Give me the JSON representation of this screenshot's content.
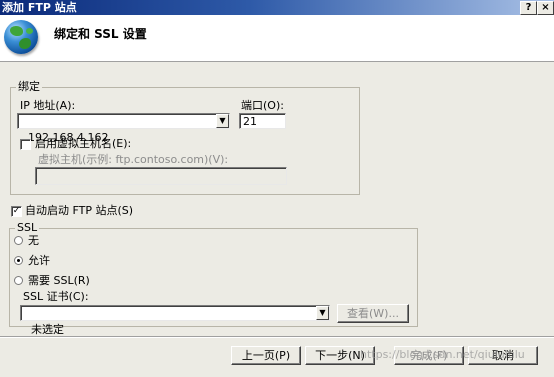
{
  "window": {
    "title": "添加 FTP 站点",
    "help_glyph": "?",
    "close_glyph": "×"
  },
  "header": {
    "icon": "globe-icon",
    "title": "绑定和 SSL 设置"
  },
  "binding": {
    "legend": "绑定",
    "ip_label": "IP 地址(A):",
    "ip_value": "192.168.4.162",
    "port_label": "端口(O):",
    "port_value": "21",
    "virtual_host_checkbox_label": "启用虚拟主机名(E):",
    "virtual_host_checked": false,
    "virtual_host_label": "虚拟主机(示例: ftp.contoso.com)(V):",
    "virtual_host_value": ""
  },
  "auto_start": {
    "label": "自动启动 FTP 站点(S)",
    "checked": true
  },
  "ssl": {
    "legend": "SSL",
    "options": [
      {
        "label": "无",
        "selected": false
      },
      {
        "label": "允许",
        "selected": true
      },
      {
        "label": "需要 SSL(R)",
        "selected": false
      }
    ],
    "cert_label": "SSL 证书(C):",
    "cert_value": "未选定",
    "view_button": "查看(W)..."
  },
  "footer": {
    "prev": "上一页(P)",
    "next": "下一步(N)",
    "finish": "完成(F)",
    "cancel": "取消"
  },
  "watermark": "https://blog.csdn.net/qiulululu"
}
